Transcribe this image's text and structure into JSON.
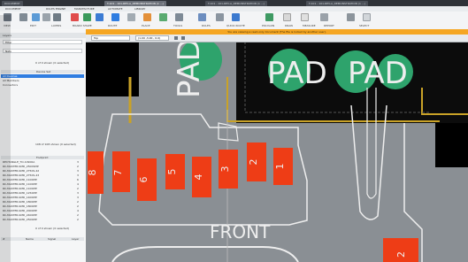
{
  "tabs": [
    {
      "label": "DOCUMENT"
    },
    {
      "label": "T-101 - 101-REV-A_DEMONSTRATION (1 ...)"
    },
    {
      "label": "T-101 - 101-REV-A_DEMONSTRATION (1 ...)"
    },
    {
      "label": "T-101 - 101-REV-A_DEMONSTRATION (1 ...)"
    }
  ],
  "menu": [
    "DOCUMENT",
    "RULES ENGINE",
    "MANUFACTURE",
    "AUTOMATE",
    "LIBRARY"
  ],
  "ribbon": {
    "groups": [
      "VIEW",
      "EDIT",
      "LAYERS",
      "BOARD SHAPE",
      "ROUTE",
      "PLACE",
      "TOOLS",
      "RULES",
      "QUICK ROUTE",
      "POLYGON",
      "DRAW",
      "MEASURE",
      "REPORT",
      "SELECT"
    ]
  },
  "notice": "You are viewing a read-only document (The file is locked by another user).",
  "left": {
    "panel1_title": "Layers",
    "panel1_field": "Filter",
    "panel1_dropdown": "Nets",
    "panel1_count": "0 of 0 shown (0 selected)",
    "device_header": "Device Set",
    "device_rows": [
      "All Devices",
      "All Members",
      "Connectors"
    ],
    "panel2_count": "108 of 108 shown (0 selected)",
    "footprint_header": "Footprint",
    "footprints": [
      {
        "name": "RECTANGLE_TO-10900A",
        "n": "3"
      },
      {
        "name": "RC-MASTER-SMD_2500SMP",
        "n": "2"
      },
      {
        "name": "RC-MASTER-SMD_2750S-42",
        "n": "3"
      },
      {
        "name": "RC-MASTER-SMD_2750S-43",
        "n": "3"
      },
      {
        "name": "RC-MASTER-SMD_1100MP",
        "n": "6"
      },
      {
        "name": "RC-MASTER-SMD_1100MP",
        "n": "4"
      },
      {
        "name": "RC-MASTER-SMD_1100MP",
        "n": "2"
      },
      {
        "name": "RC-MASTER-SMD_1250MP",
        "n": "3"
      },
      {
        "name": "RC-MASTER-SMD_1400MP",
        "n": "3"
      },
      {
        "name": "RC-MASTER-SMD_1800MP",
        "n": "2"
      },
      {
        "name": "RC-MASTER-SMD_1800MP",
        "n": "2"
      },
      {
        "name": "RC-MASTER-SMD_2000MP",
        "n": "4"
      },
      {
        "name": "RC-MASTER-SMD_2400MP",
        "n": "2"
      },
      {
        "name": "RC-MASTER-SMD_2500MP",
        "n": "2"
      }
    ],
    "panel3_count": "0 of 0 shown (0 selected)",
    "bottom_cols": [
      "#",
      "Name",
      "Signal",
      "Layer"
    ]
  },
  "canvas": {
    "layer_select": "Top",
    "coord": "(1.00 ,3.00 , 0.0)",
    "zoom_hint": "",
    "labels": {
      "pad_a": "PAD",
      "pad_b": "PAD",
      "pad_c": "PAD",
      "front": "FRONT",
      "pin_numbers": [
        "8",
        "7",
        "6",
        "5",
        "4",
        "3",
        "2",
        "1"
      ],
      "right_pad": "2"
    }
  },
  "colors": {
    "board_gray": "#8a8f94",
    "copper_gold": "#c9a227",
    "pad_green": "#2ea36c",
    "pad_orange": "#ee3d16",
    "silkscreen": "#eeeeee",
    "accent_blue": "#2f7de1",
    "notice_orange": "#f5a623"
  }
}
